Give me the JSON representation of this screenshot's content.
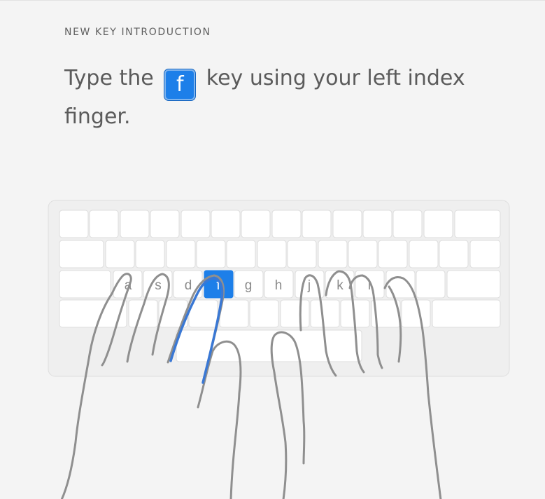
{
  "lesson": {
    "eyebrow": "NEW KEY INTRODUCTION",
    "instruction_before": "Type the",
    "key": "f",
    "instruction_after": "key using your left index finger."
  },
  "keyboard": {
    "home_row_labels": [
      "a",
      "s",
      "d",
      "f",
      "g",
      "h",
      "j",
      "k",
      "l"
    ],
    "highlighted_key": "f",
    "highlight_color": "#1d7fe9",
    "finger_highlight_color": "#3a78d4"
  }
}
